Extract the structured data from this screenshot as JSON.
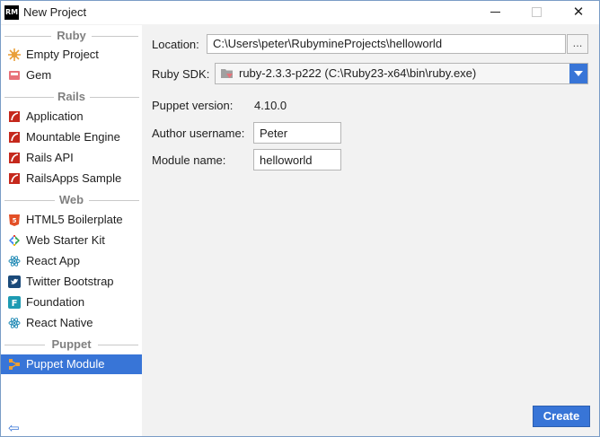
{
  "window": {
    "icon_text": "RM",
    "title": "New Project"
  },
  "sidebar": {
    "groups": [
      {
        "header": "Ruby",
        "items": [
          {
            "label": "Empty Project",
            "icon": "empty-project-icon"
          },
          {
            "label": "Gem",
            "icon": "gem-icon"
          }
        ]
      },
      {
        "header": "Rails",
        "items": [
          {
            "label": "Application",
            "icon": "rails-icon"
          },
          {
            "label": "Mountable Engine",
            "icon": "rails-icon"
          },
          {
            "label": "Rails API",
            "icon": "rails-icon"
          },
          {
            "label": "RailsApps Sample",
            "icon": "rails-icon"
          }
        ]
      },
      {
        "header": "Web",
        "items": [
          {
            "label": "HTML5 Boilerplate",
            "icon": "html5-icon"
          },
          {
            "label": "Web Starter Kit",
            "icon": "web-starter-kit-icon"
          },
          {
            "label": "React App",
            "icon": "react-icon"
          },
          {
            "label": "Twitter Bootstrap",
            "icon": "twitter-icon"
          },
          {
            "label": "Foundation",
            "icon": "foundation-icon"
          },
          {
            "label": "React Native",
            "icon": "react-icon"
          }
        ]
      },
      {
        "header": "Puppet",
        "items": [
          {
            "label": "Puppet Module",
            "icon": "puppet-icon",
            "selected": true
          }
        ]
      }
    ]
  },
  "form": {
    "location_label": "Location:",
    "location_value": "C:\\Users\\peter\\RubymineProjects\\helloworld",
    "browse_label": "...",
    "sdk_label": "Ruby SDK:",
    "sdk_value": "ruby-2.3.3-p222 (C:\\Ruby23-x64\\bin\\ruby.exe)",
    "puppet_version_label": "Puppet version:",
    "puppet_version_value": "4.10.0",
    "author_label": "Author username:",
    "author_value": "Peter",
    "module_label": "Module name:",
    "module_value": "helloworld"
  },
  "footer": {
    "create_label": "Create"
  },
  "colors": {
    "accent": "#3875d7",
    "rails_red": "#c5281c"
  }
}
